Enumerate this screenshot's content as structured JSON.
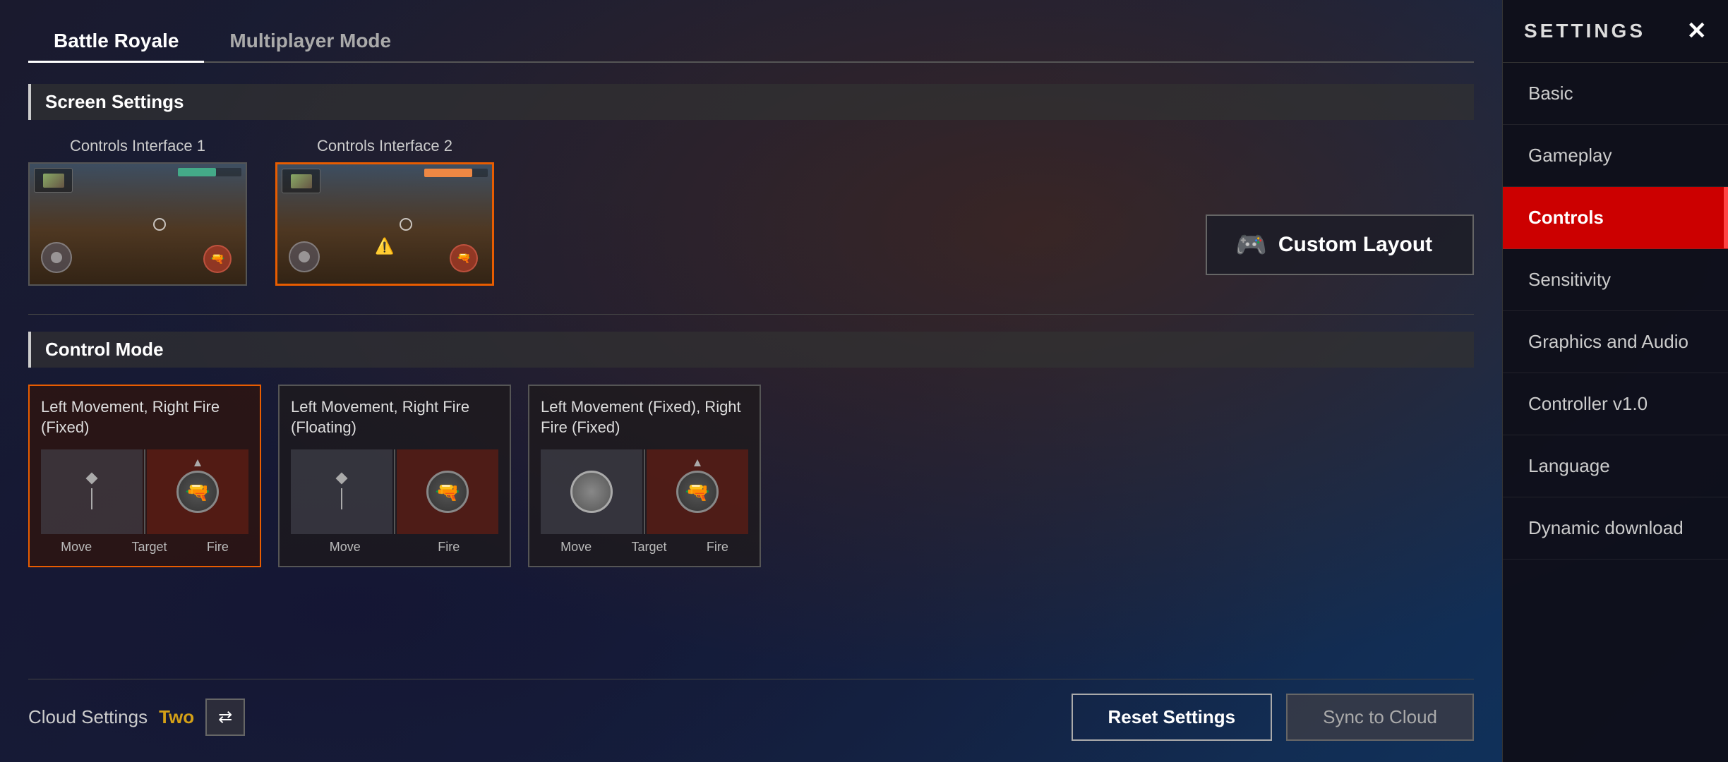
{
  "tabs": [
    {
      "id": "battle-royale",
      "label": "Battle Royale",
      "active": true
    },
    {
      "id": "multiplayer-mode",
      "label": "Multiplayer Mode",
      "active": false
    }
  ],
  "screen_settings": {
    "header": "Screen Settings",
    "interfaces": [
      {
        "id": "interface-1",
        "label": "Controls Interface 1",
        "selected": false
      },
      {
        "id": "interface-2",
        "label": "Controls Interface 2",
        "selected": true
      }
    ],
    "custom_layout_btn": "Custom Layout"
  },
  "control_mode": {
    "header": "Control Mode",
    "modes": [
      {
        "id": "mode-1",
        "title": "Left Movement, Right Fire (Fixed)",
        "selected": true,
        "labels": [
          "Move",
          "Target",
          "Fire"
        ]
      },
      {
        "id": "mode-2",
        "title": "Left Movement, Right Fire (Floating)",
        "selected": false,
        "labels": [
          "Move",
          "",
          "Fire"
        ]
      },
      {
        "id": "mode-3",
        "title": "Left Movement (Fixed), Right Fire (Fixed)",
        "selected": false,
        "labels": [
          "Move",
          "Target",
          "Fire"
        ]
      }
    ]
  },
  "bottom_bar": {
    "cloud_settings_label": "Cloud Settings",
    "cloud_value": "Two",
    "reset_btn": "Reset Settings",
    "sync_btn": "Sync to Cloud"
  },
  "sidebar": {
    "title": "SETTINGS",
    "close_icon": "✕",
    "items": [
      {
        "id": "basic",
        "label": "Basic",
        "active": false
      },
      {
        "id": "gameplay",
        "label": "Gameplay",
        "active": false
      },
      {
        "id": "controls",
        "label": "Controls",
        "active": true
      },
      {
        "id": "sensitivity",
        "label": "Sensitivity",
        "active": false
      },
      {
        "id": "graphics-audio",
        "label": "Graphics and Audio",
        "active": false
      },
      {
        "id": "controller",
        "label": "Controller v1.0",
        "active": false
      },
      {
        "id": "language",
        "label": "Language",
        "active": false
      },
      {
        "id": "dynamic-download",
        "label": "Dynamic download",
        "active": false
      }
    ]
  }
}
